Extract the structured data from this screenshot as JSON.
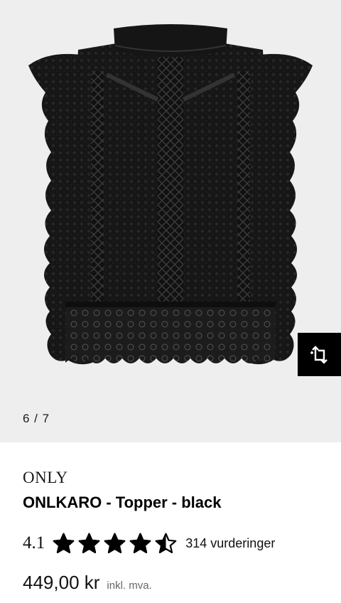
{
  "gallery": {
    "counter": "6 / 7",
    "compare_icon": "compare-arrows-icon",
    "background": "#eeeeee"
  },
  "product": {
    "brand": "ONLY",
    "name": "ONLKARO - Topper - black",
    "rating": "4.1",
    "rating_value": 4.1,
    "rating_max": 5,
    "reviews": "314 vurderinger",
    "price": "449,00 kr",
    "vat_note": "inkl. mva."
  }
}
